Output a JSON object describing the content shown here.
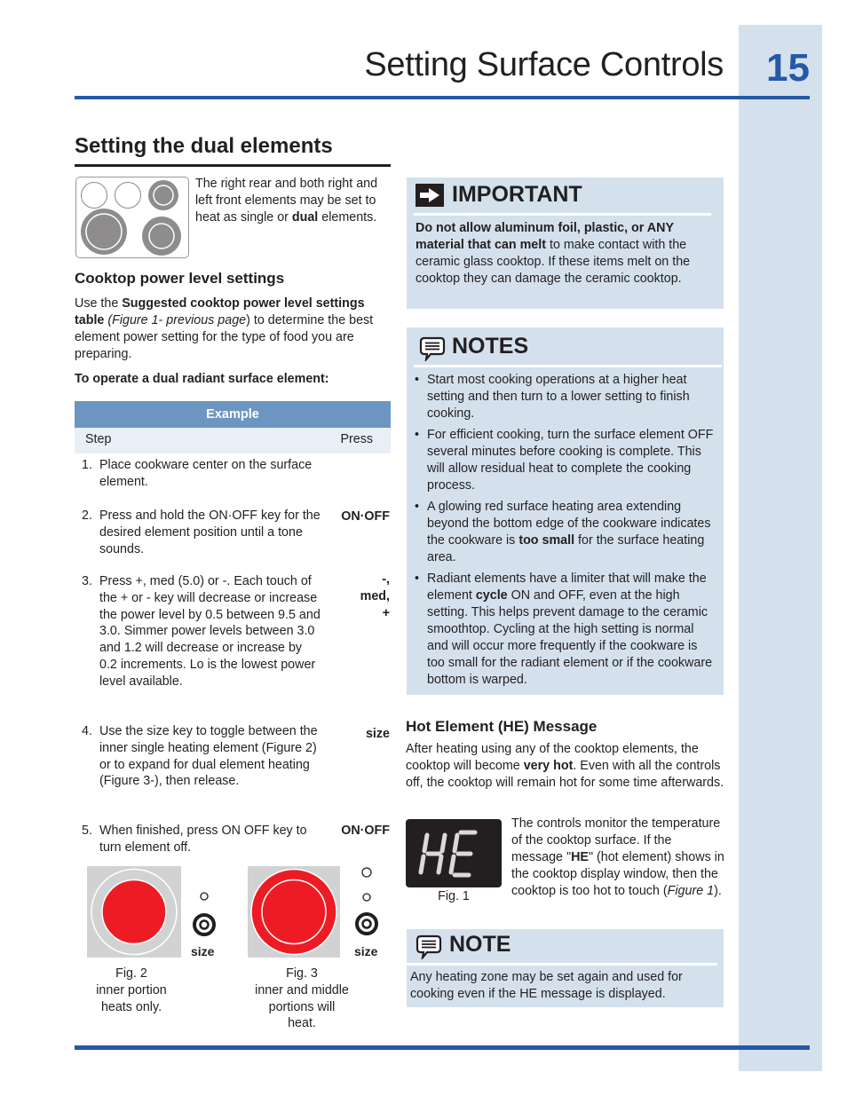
{
  "header": {
    "title": "Setting Surface Controls",
    "page_number": "15",
    "accent_color": "#2559a8",
    "sidebar_color": "#d4e1ed"
  },
  "section": {
    "title": "Setting the dual elements",
    "intro_pre": "The right rear and both right and left front elements may be set to heat as single or ",
    "intro_bold": "dual",
    "intro_post": " elements.",
    "cooktop_icon": "cooktop-diagram-icon"
  },
  "power_levels": {
    "title": "Cooktop power level settings",
    "para_pre": "Use  the ",
    "para_bold": "Suggested cooktop power level settings table",
    "para_italic": " (Figure 1- previous page",
    "para_post": ") to determine the best element power setting for the type of food you are preparing.",
    "operate_heading": "To operate a dual radiant surface element:"
  },
  "table": {
    "header": "Example",
    "columns": [
      "Step",
      "Press"
    ],
    "rows": [
      {
        "num": "1.",
        "step": "Place cookware center on the surface element.",
        "press": ""
      },
      {
        "num": "2.",
        "step": "Press and hold the ON·OFF key for the desired element position until a tone sounds.",
        "press": "ON·OFF"
      },
      {
        "num": "3.",
        "step": "Press +, med (5.0) or -. Each touch of the + or - key will decrease or increase the power level by 0.5 between 9.5 and 3.0. Simmer power levels between 3.0 and 1.2 will decrease or increase by 0.2 increments. Lo is the lowest power level available.",
        "press_lines": [
          "-,",
          "med,",
          "+"
        ]
      },
      {
        "num": "4.",
        "step": "Use the size key to toggle between the inner single heating element (Figure 2) or to expand for dual element heating (Figure 3-), then release.",
        "press": "size"
      },
      {
        "num": "5.",
        "step": "When finished, press ON OFF key to turn element off.",
        "press": "ON·OFF"
      }
    ]
  },
  "figures": {
    "fig2": {
      "size_label": "size",
      "caption_lines": [
        "Fig. 2",
        "inner portion",
        "heats only."
      ]
    },
    "fig3": {
      "size_label": "size",
      "caption_lines": [
        "Fig. 3",
        "inner and middle",
        "portions will",
        "heat."
      ]
    },
    "heat_color": "#ed1c24"
  },
  "important": {
    "heading": "IMPORTANT",
    "icon": "arrow-right-icon",
    "body_bold": "Do not allow aluminum foil, plastic, or ANY material that can melt",
    "body_post": " to make contact with the ceramic glass cooktop. If these items melt on the cooktop they can damage the ceramic cooktop."
  },
  "notes": {
    "heading": "NOTES",
    "icon": "speech-bubble-icon",
    "items": [
      {
        "pre": "Start most cooking operations at a higher heat setting and then turn to a lower setting to finish cooking.",
        "bold": "",
        "post": ""
      },
      {
        "pre": "For efficient cooking, turn the surface element OFF several minutes before cooking is complete. This will allow residual heat to complete the cooking process.",
        "bold": "",
        "post": ""
      },
      {
        "pre": "A glowing red surface heating area extending beyond the bottom edge of the cookware indicates the cookware is ",
        "bold": "too small",
        "post": " for the surface heating area."
      },
      {
        "pre": "Radiant elements have a limiter that will make the element ",
        "bold": "cycle",
        "post": " ON and OFF, even at the high setting. This helps prevent damage to the ceramic smoothtop. Cycling at the high setting is normal and will occur more frequently if the cookware is too small for the radiant element or if the cookware bottom is warped."
      }
    ]
  },
  "hot_element": {
    "title": "Hot Element (HE) Message",
    "para_pre": "After heating using any of the cooktop elements, the cooktop will become ",
    "para_bold": "very hot",
    "para_post": ". Even with all the controls off, the cooktop will remain hot for some time afterwards.",
    "display_text": "HE",
    "fig_caption": "Fig. 1",
    "desc_pre": "The controls monitor the temperature of the cooktop surface. If the message \"",
    "desc_bold": "HE",
    "desc_mid": "\" (hot element) shows in the cooktop display window, then the cooktop is too hot to touch (",
    "desc_italic": "Figure 1",
    "desc_post": ")."
  },
  "note": {
    "heading": "NOTE",
    "icon": "speech-bubble-icon",
    "body": "Any heating zone may be set again and used for cooking even if the HE message is displayed."
  }
}
